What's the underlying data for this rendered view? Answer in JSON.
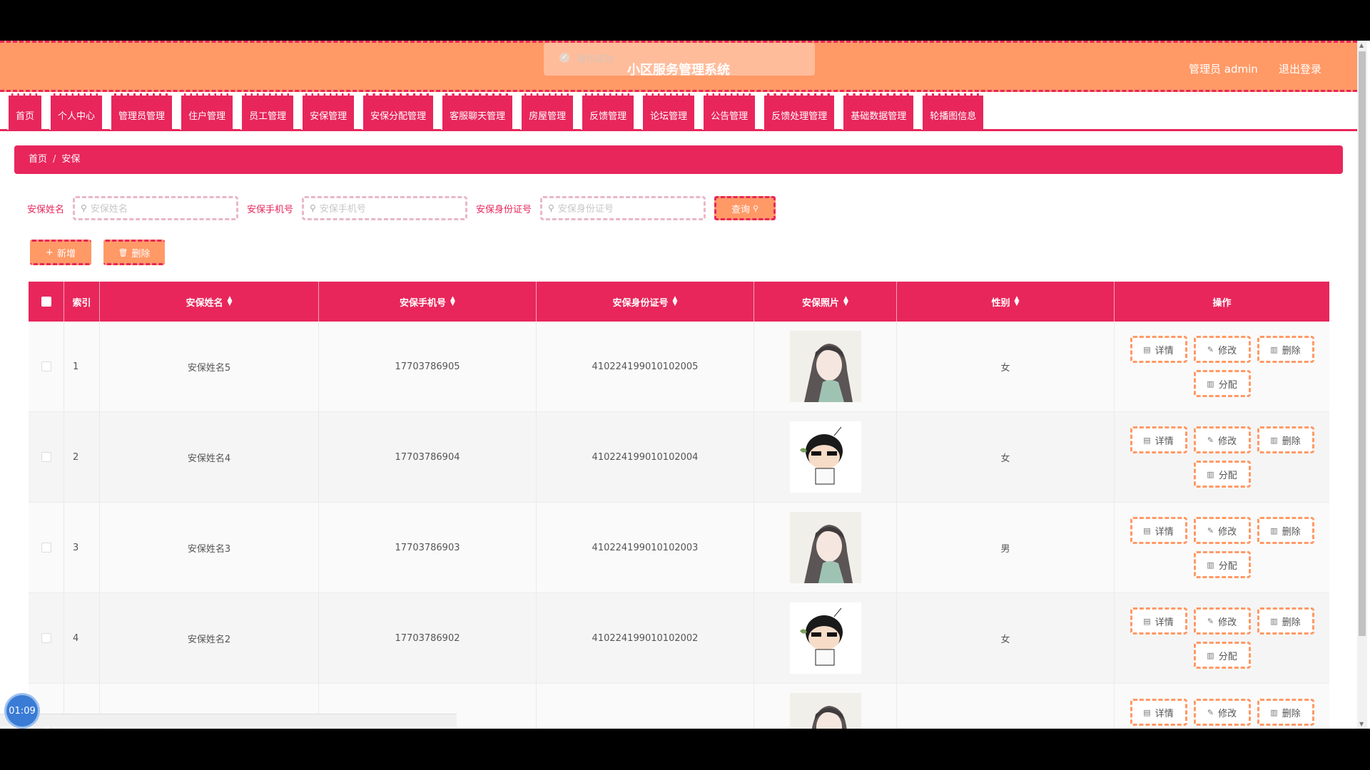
{
  "header": {
    "title": "小区服务管理系统",
    "admin_label": "管理员 admin",
    "logout": "退出登录",
    "toast": "操作成功"
  },
  "nav": {
    "items": [
      "首页",
      "个人中心",
      "管理员管理",
      "住户管理",
      "员工管理",
      "安保管理",
      "安保分配管理",
      "客服聊天管理",
      "房屋管理",
      "反馈管理",
      "论坛管理",
      "公告管理",
      "反馈处理管理",
      "基础数据管理",
      "轮播图信息"
    ]
  },
  "breadcrumb": {
    "home": "首页",
    "sep": "/",
    "current": "安保"
  },
  "search": {
    "name_label": "安保姓名",
    "name_placeholder": "安保姓名",
    "phone_label": "安保手机号",
    "phone_placeholder": "安保手机号",
    "id_label": "安保身份证号",
    "id_placeholder": "安保身份证号",
    "query_button": "查询"
  },
  "actions": {
    "add": "新增",
    "delete": "删除"
  },
  "table": {
    "headers": {
      "index": "索引",
      "name": "安保姓名",
      "phone": "安保手机号",
      "idcard": "安保身份证号",
      "photo": "安保照片",
      "gender": "性别",
      "ops": "操作"
    },
    "op_labels": {
      "detail": "详情",
      "edit": "修改",
      "delete": "删除",
      "assign": "分配"
    },
    "rows": [
      {
        "index": "1",
        "name": "安保姓名5",
        "phone": "17703786905",
        "idcard": "410224199010102005",
        "photo": "girl-avatar",
        "gender": "女"
      },
      {
        "index": "2",
        "name": "安保姓名4",
        "phone": "17703786904",
        "idcard": "410224199010102004",
        "photo": "cartoon-boy-avatar",
        "gender": "女"
      },
      {
        "index": "3",
        "name": "安保姓名3",
        "phone": "17703786903",
        "idcard": "410224199010102003",
        "photo": "girl-avatar",
        "gender": "男"
      },
      {
        "index": "4",
        "name": "安保姓名2",
        "phone": "17703786902",
        "idcard": "410224199010102002",
        "photo": "cartoon-boy-avatar",
        "gender": "女"
      }
    ]
  },
  "overlay": {
    "timer": "01:09"
  },
  "colors": {
    "primary": "#e8265b",
    "accent": "#ff9966"
  }
}
